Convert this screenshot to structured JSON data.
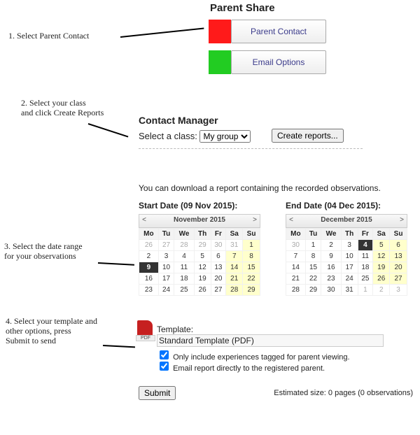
{
  "title": "Parent Share",
  "steps": {
    "s1": "1. Select Parent Contact",
    "s2": "2. Select your class\nand click Create Reports",
    "s3": "3. Select the date range\nfor your observations",
    "s4": "4. Select your template and\nother options, press\nSubmit to send"
  },
  "buttons": {
    "parent_contact": "Parent Contact",
    "email_options": "Email Options"
  },
  "contact_manager": {
    "title": "Contact Manager",
    "select_label": "Select a class:",
    "class_value": "My group",
    "create_reports": "Create reports..."
  },
  "desc": "You can download a report containing the recorded observations.",
  "start_date_label": "Start Date (09 Nov 2015):",
  "end_date_label": "End Date (04 Dec 2015):",
  "cal_left": {
    "month": "November 2015",
    "rows": [
      [
        "26",
        "27",
        "28",
        "29",
        "30",
        "31",
        "1"
      ],
      [
        "2",
        "3",
        "4",
        "5",
        "6",
        "7",
        "8"
      ],
      [
        "9",
        "10",
        "11",
        "12",
        "13",
        "14",
        "15"
      ],
      [
        "16",
        "17",
        "18",
        "19",
        "20",
        "21",
        "22"
      ],
      [
        "23",
        "24",
        "25",
        "26",
        "27",
        "28",
        "29"
      ]
    ],
    "dim_first_row": 6,
    "selected": [
      2,
      0
    ]
  },
  "cal_right": {
    "month": "December 2015",
    "rows": [
      [
        "30",
        "1",
        "2",
        "3",
        "4",
        "5",
        "6"
      ],
      [
        "7",
        "8",
        "9",
        "10",
        "11",
        "12",
        "13"
      ],
      [
        "14",
        "15",
        "16",
        "17",
        "18",
        "19",
        "20"
      ],
      [
        "21",
        "22",
        "23",
        "24",
        "25",
        "26",
        "27"
      ],
      [
        "28",
        "29",
        "30",
        "31",
        "1",
        "2",
        "3"
      ]
    ],
    "dim_first_row": 1,
    "dim_last_row_from": 4,
    "selected": [
      0,
      4
    ]
  },
  "dow": [
    "Mo",
    "Tu",
    "We",
    "Th",
    "Fr",
    "Sa",
    "Su"
  ],
  "template": {
    "label": "Template:",
    "value": "Standard Template (PDF)"
  },
  "checks": {
    "c1": "Only include experiences tagged for parent viewing.",
    "c2": "Email report directly to the registered parent."
  },
  "submit": "Submit",
  "estimated": "Estimated size: 0 pages (0 observations)"
}
